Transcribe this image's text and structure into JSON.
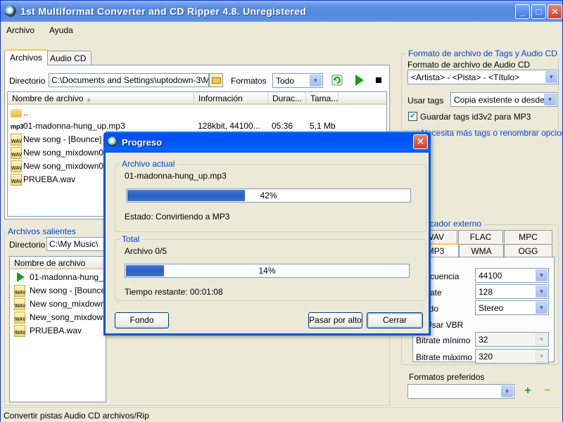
{
  "window": {
    "title": "1st Multiformat Converter and CD Ripper 4.8. Unregistered"
  },
  "menu": [
    "Archivo",
    "Ayuda"
  ],
  "left": {
    "tabs": [
      "Archivos",
      "Audio CD"
    ],
    "dir_label": "Directorio",
    "dir_value": "C:\\Documents and Settings\\uptodown-3\\Mis",
    "formats_label": "Formatos",
    "formats_value": "Todo",
    "columns": [
      "Nombre de archivo",
      "Información",
      "Durac...",
      "Tama..."
    ],
    "files": [
      {
        "icon": "folder",
        "name": "..",
        "info": "",
        "dur": "",
        "size": ""
      },
      {
        "icon": "mp3",
        "name": "01-madonna-hung_up.mp3",
        "info": "128kbit, 44100...",
        "dur": "05:36",
        "size": "5,1 Mb"
      },
      {
        "icon": "wav",
        "name": "New song - [Bounce]",
        "info": "",
        "dur": "",
        "size": ""
      },
      {
        "icon": "wav",
        "name": "New song_mixdown01",
        "info": "",
        "dur": "",
        "size": ""
      },
      {
        "icon": "wav",
        "name": "New song_mixdown02",
        "info": "",
        "dur": "",
        "size": ""
      },
      {
        "icon": "wav",
        "name": "PRUEBA.wav",
        "info": "",
        "dur": "",
        "size": ""
      }
    ],
    "outgoing_label": "Archivos salientes",
    "out_dir_label": "Directorio",
    "out_dir_value": "C:\\My Music\\",
    "out_column": "Nombre de archivo",
    "out_files": [
      {
        "icon": "play",
        "name": "01-madonna-hung_up"
      },
      {
        "icon": "wav",
        "name": "New song - [Bounce]"
      },
      {
        "icon": "wav",
        "name": "New song_mixdown0"
      },
      {
        "icon": "wav",
        "name": "New_song_mixdown0"
      },
      {
        "icon": "wav",
        "name": "PRUEBA.wav"
      }
    ]
  },
  "right": {
    "tags_group_title": "Formato de archivo de Tags y Audio CD",
    "cd_format_label": "Formato de archivo de Audio CD",
    "cd_format_value": "<Artista> - <Pista> - <Título>",
    "use_tags_label": "Usar tags",
    "use_tags_value": "Copia existente o desde C",
    "save_id3_label": "Guardar tags id3v2 para MP3",
    "more_tags_link": "¿Necesita más tags o renombrar opciones?",
    "encoder_title": "Codificador externo",
    "encoder_tabs_row1": [
      "WAV",
      "FLAC",
      "MPC"
    ],
    "encoder_tabs_row2": [
      "MP3",
      "WMA",
      "OGG"
    ],
    "freq_label": "Frecuencia",
    "freq_value": "44100",
    "bitrate_label": "Bitrate",
    "bitrate_value": "128",
    "mode_label": "Modo",
    "mode_value": "Stereo",
    "vbr_label": "Usar VBR",
    "min_bitrate_label": "Bitrate mínimo",
    "min_bitrate_value": "32",
    "max_bitrate_label": "Bitrate máximo",
    "max_bitrate_value": "320",
    "preferred_label": "Formatos preferidos",
    "preferred_value": ""
  },
  "status": "Convertir pistas Audio CD archivos/Rip",
  "dialog": {
    "title": "Progreso",
    "current_group": "Archivo actual",
    "current_file": "01-madonna-hung_up.mp3",
    "current_progress": 0.42,
    "current_percent": "42%",
    "state_text": "Estado: Convirtiendo a MP3",
    "total_group": "Total",
    "total_files": "Archivo 0/5",
    "total_progress": 0.14,
    "total_percent": "14%",
    "time_left": "Tiempo restante: 00:01:08",
    "btn_background": "Fondo",
    "btn_skip": "Pasar por alto",
    "btn_close": "Cerrar"
  }
}
